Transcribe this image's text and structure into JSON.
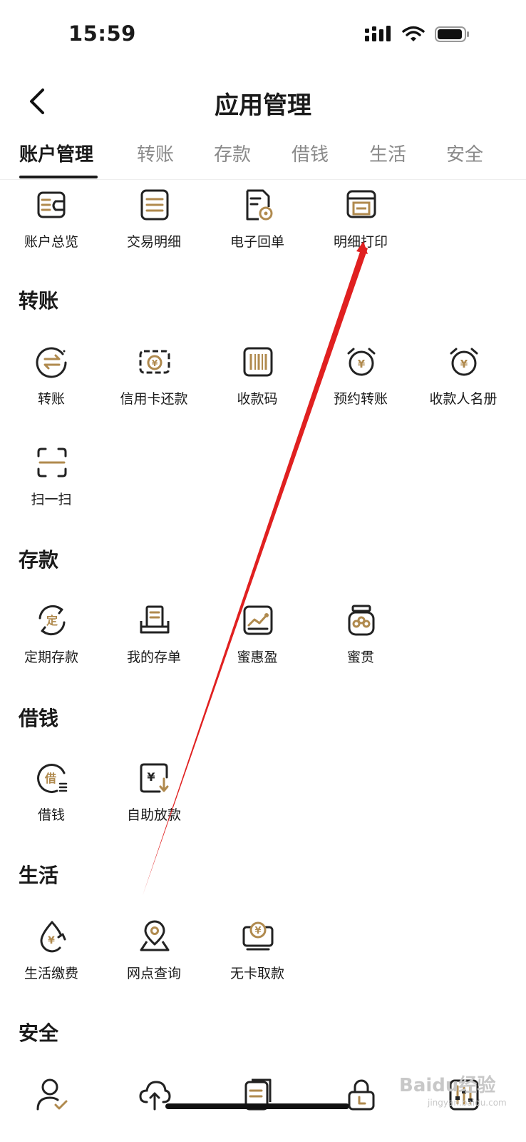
{
  "status": {
    "time": "15:59"
  },
  "header": {
    "title": "应用管理"
  },
  "tabs": [
    {
      "label": "账户管理",
      "active": true
    },
    {
      "label": "转账"
    },
    {
      "label": "存款"
    },
    {
      "label": "借钱"
    },
    {
      "label": "生活"
    },
    {
      "label": "安全"
    }
  ],
  "account_section": {
    "items": [
      {
        "label": "账户总览",
        "icon": "wallet-icon"
      },
      {
        "label": "交易明细",
        "icon": "list-icon"
      },
      {
        "label": "电子回单",
        "icon": "receipt-icon"
      },
      {
        "label": "明细打印",
        "icon": "printer-icon"
      }
    ]
  },
  "transfer_section": {
    "title": "转账",
    "items": [
      {
        "label": "转账",
        "icon": "transfer-icon"
      },
      {
        "label": "信用卡还款",
        "icon": "credit-card-repay-icon"
      },
      {
        "label": "收款码",
        "icon": "barcode-icon"
      },
      {
        "label": "预约转账",
        "icon": "alarm-clock-icon"
      },
      {
        "label": "收款人名册",
        "icon": "alarm-clock-icon"
      },
      {
        "label": "扫一扫",
        "icon": "scan-icon"
      }
    ]
  },
  "deposit_section": {
    "title": "存款",
    "items": [
      {
        "label": "定期存款",
        "icon": "fixed-deposit-icon",
        "glyph": "定"
      },
      {
        "label": "我的存单",
        "icon": "deposit-slip-icon"
      },
      {
        "label": "蜜惠盈",
        "icon": "chart-trend-icon"
      },
      {
        "label": "蜜贯",
        "icon": "jar-icon"
      }
    ]
  },
  "borrow_section": {
    "title": "借钱",
    "items": [
      {
        "label": "借钱",
        "icon": "borrow-icon",
        "glyph": "借"
      },
      {
        "label": "自助放款",
        "icon": "self-loan-icon"
      }
    ]
  },
  "life_section": {
    "title": "生活",
    "items": [
      {
        "label": "生活缴费",
        "icon": "bill-payment-icon"
      },
      {
        "label": "网点查询",
        "icon": "location-pin-icon"
      },
      {
        "label": "无卡取款",
        "icon": "cardless-withdraw-icon"
      }
    ]
  },
  "security_section": {
    "title": "安全",
    "items": [
      {
        "icon": "user-verify-icon"
      },
      {
        "icon": "cloud-upload-icon"
      },
      {
        "icon": "document-icon"
      },
      {
        "icon": "lock-icon"
      },
      {
        "icon": "settings-sliders-icon"
      }
    ]
  },
  "currency_symbol": "¥",
  "watermark": {
    "brand": "Baidu经验",
    "url": "jingyan.baidu.com"
  },
  "colors": {
    "accent": "#b08a4e",
    "text": "#1a1a1a",
    "muted": "#8a8a8a",
    "annotation_red": "#e02020"
  }
}
